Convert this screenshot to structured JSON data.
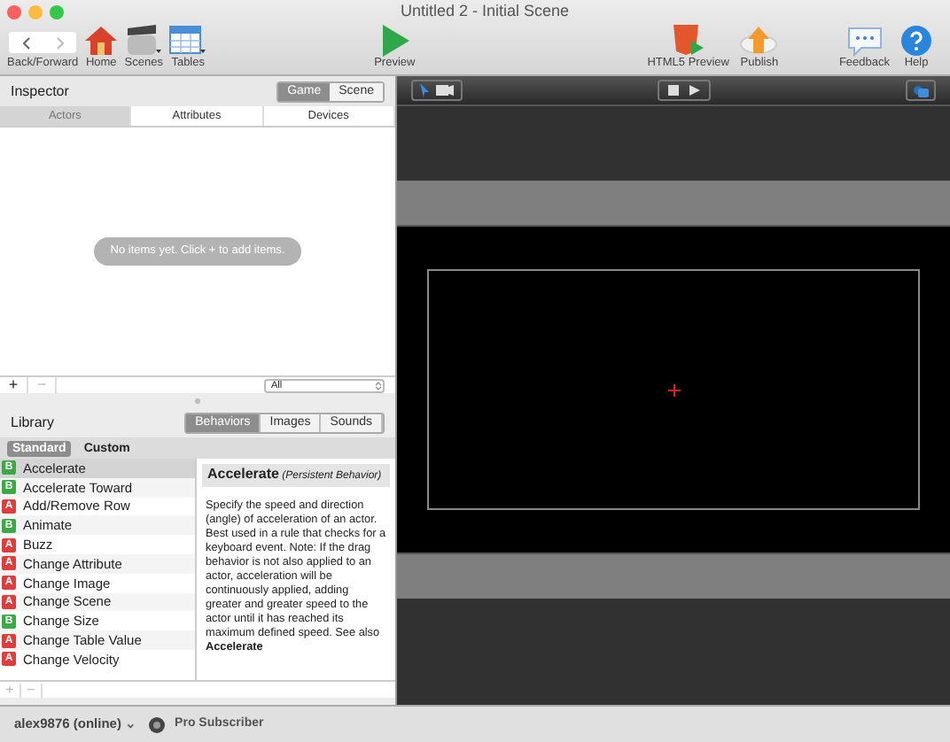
{
  "window": {
    "title": "Untitled 2 - Initial Scene"
  },
  "toolbar_left": [
    {
      "label": "Back/Forward",
      "kind": "nav"
    },
    {
      "label": "Home",
      "kind": "home"
    },
    {
      "label": "Scenes",
      "kind": "scenes"
    },
    {
      "label": "Tables",
      "kind": "tables"
    }
  ],
  "toolbar_center": {
    "label": "Preview"
  },
  "toolbar_right": [
    {
      "label": "HTML5 Preview",
      "kind": "html5"
    },
    {
      "label": "Publish",
      "kind": "publish"
    },
    {
      "label": "Feedback",
      "kind": "feedback"
    },
    {
      "label": "Help",
      "kind": "help"
    }
  ],
  "inspector": {
    "title": "Inspector",
    "scope": [
      {
        "label": "Game",
        "selected": true
      },
      {
        "label": "Scene",
        "selected": false
      }
    ],
    "tabs": [
      {
        "label": "Actors",
        "selected": true
      },
      {
        "label": "Attributes",
        "selected": false
      },
      {
        "label": "Devices",
        "selected": false
      }
    ],
    "empty_message": "No items yet. Click + to add items.",
    "add": "+",
    "remove": "−",
    "filter": "All"
  },
  "library": {
    "title": "Library",
    "tabs": [
      {
        "label": "Behaviors",
        "selected": true
      },
      {
        "label": "Images",
        "selected": false
      },
      {
        "label": "Sounds",
        "selected": false
      }
    ],
    "subtabs": [
      {
        "label": "Standard",
        "selected": true
      },
      {
        "label": "Custom",
        "selected": false
      }
    ],
    "items": [
      {
        "badge": "B",
        "kind": "behavior",
        "label": "Accelerate",
        "selected": true
      },
      {
        "badge": "B",
        "kind": "behavior",
        "label": "Accelerate Toward",
        "selected": false
      },
      {
        "badge": "A",
        "kind": "action",
        "label": "Add/Remove Row",
        "selected": false
      },
      {
        "badge": "B",
        "kind": "behavior",
        "label": "Animate",
        "selected": false
      },
      {
        "badge": "A",
        "kind": "action",
        "label": "Buzz",
        "selected": false
      },
      {
        "badge": "A",
        "kind": "action",
        "label": "Change Attribute",
        "selected": false
      },
      {
        "badge": "A",
        "kind": "action",
        "label": "Change Image",
        "selected": false
      },
      {
        "badge": "A",
        "kind": "action",
        "label": "Change Scene",
        "selected": false
      },
      {
        "badge": "B",
        "kind": "behavior",
        "label": "Change Size",
        "selected": false
      },
      {
        "badge": "A",
        "kind": "action",
        "label": "Change Table Value",
        "selected": false
      },
      {
        "badge": "A",
        "kind": "action",
        "label": "Change Velocity",
        "selected": false
      }
    ],
    "detail": {
      "title": "Accelerate",
      "subtitle": "(Persistent Behavior)",
      "body": "Specify the speed and direction (angle) of acceleration of an actor. Best used in a rule that checks for a keyboard event. Note: If the drag behavior is not also applied to an actor, acceleration will be continuously applied, adding greater and greater speed to the actor until it has reached its maximum defined speed. See also **Accelerate**"
    },
    "add": "+",
    "remove": "−"
  },
  "status_bar": {
    "user": "alex9876 (online)",
    "caret": "⌄",
    "plan": "Pro Subscriber"
  }
}
